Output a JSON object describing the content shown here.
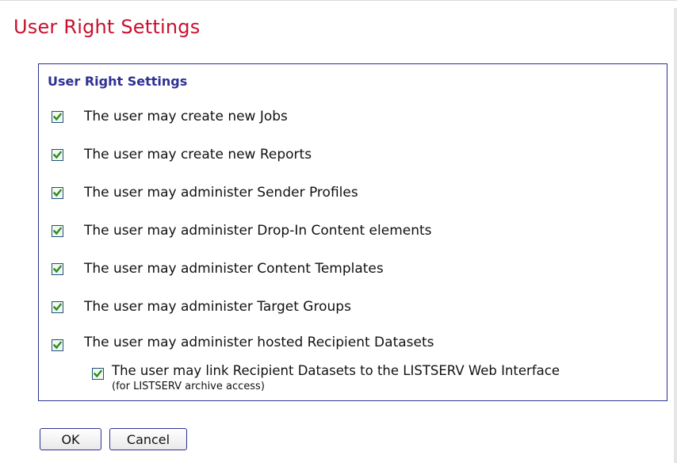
{
  "page": {
    "title": "User Right Settings"
  },
  "panel": {
    "title": "User Right Settings",
    "options": [
      {
        "label": "The user may create new Jobs",
        "checked": true
      },
      {
        "label": "The user may create new Reports",
        "checked": true
      },
      {
        "label": "The user may administer Sender Profiles",
        "checked": true
      },
      {
        "label": "The user may administer Drop-In Content elements",
        "checked": true
      },
      {
        "label": "The user may administer Content Templates",
        "checked": true
      },
      {
        "label": "The user may administer Target Groups",
        "checked": true
      },
      {
        "label": "The user may administer hosted Recipient Datasets",
        "checked": true
      }
    ],
    "sub_option": {
      "label": "The user may link Recipient Datasets to the LISTSERV Web Interface",
      "note": "(for LISTSERV archive access)",
      "checked": true
    }
  },
  "buttons": {
    "ok_label": "OK",
    "cancel_label": "Cancel"
  },
  "colors": {
    "page_title": "#c8102e",
    "panel_accent": "#2e3192",
    "checkmark": "#2e8b22"
  },
  "icons": {
    "checkbox_checked": "checkmark-icon"
  }
}
